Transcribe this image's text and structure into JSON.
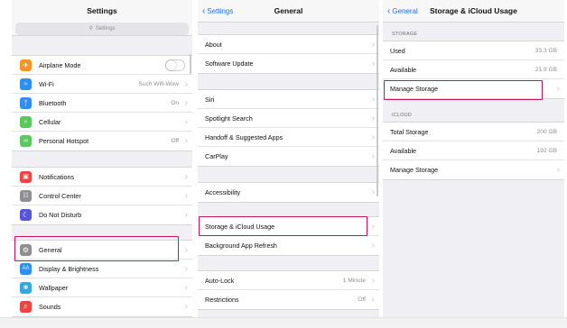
{
  "panels": {
    "settings": {
      "title": "Settings",
      "search_placeholder": "Settings",
      "group1": [
        {
          "label": "Airplane Mode",
          "icon": "airplane-icon",
          "color": "#f7931e",
          "toggle": false
        },
        {
          "label": "Wi-Fi",
          "icon": "wifi-icon",
          "color": "#2e8ff0",
          "value": "Such Wifi-Wow"
        },
        {
          "label": "Bluetooth",
          "icon": "bluetooth-icon",
          "color": "#2e8ff0",
          "value": "On"
        },
        {
          "label": "Cellular",
          "icon": "cellular-icon",
          "color": "#5ac85a",
          "value": ""
        },
        {
          "label": "Personal Hotspot",
          "icon": "hotspot-icon",
          "color": "#5ac85a",
          "value": "Off"
        }
      ],
      "group2": [
        {
          "label": "Notifications",
          "icon": "notifications-icon",
          "color": "#e8463f"
        },
        {
          "label": "Control Center",
          "icon": "control-center-icon",
          "color": "#8e8e93"
        },
        {
          "label": "Do Not Disturb",
          "icon": "moon-icon",
          "color": "#5856d6"
        }
      ],
      "group3": [
        {
          "label": "General",
          "icon": "gear-icon",
          "color": "#8e8e93"
        },
        {
          "label": "Display & Brightness",
          "icon": "display-icon",
          "color": "#2e8ff0"
        },
        {
          "label": "Wallpaper",
          "icon": "wallpaper-icon",
          "color": "#32a8e0"
        },
        {
          "label": "Sounds",
          "icon": "sounds-icon",
          "color": "#e8463f"
        }
      ]
    },
    "general": {
      "back": "Settings",
      "title": "General",
      "group1": [
        {
          "label": "About"
        },
        {
          "label": "Software Update"
        }
      ],
      "group2": [
        {
          "label": "Siri"
        },
        {
          "label": "Spotlight Search"
        },
        {
          "label": "Handoff & Suggested Apps"
        },
        {
          "label": "CarPlay"
        }
      ],
      "group3": [
        {
          "label": "Accessibility"
        }
      ],
      "group4": [
        {
          "label": "Storage & iCloud Usage"
        },
        {
          "label": "Background App Refresh"
        }
      ],
      "group5": [
        {
          "label": "Auto-Lock",
          "value": "1 Minute"
        },
        {
          "label": "Restrictions",
          "value": "Off"
        }
      ]
    },
    "storage": {
      "back": "General",
      "title": "Storage & iCloud Usage",
      "storage_header": "STORAGE",
      "storage_rows": [
        {
          "label": "Used",
          "value": "33.3 GB"
        },
        {
          "label": "Available",
          "value": "21.9 GB"
        },
        {
          "label": "Manage Storage",
          "value": ""
        }
      ],
      "icloud_header": "ICLOUD",
      "icloud_rows": [
        {
          "label": "Total Storage",
          "value": "200 GB"
        },
        {
          "label": "Available",
          "value": "192 GB"
        },
        {
          "label": "Manage Storage",
          "value": ""
        }
      ]
    }
  },
  "highlight_color": "#c3165c"
}
